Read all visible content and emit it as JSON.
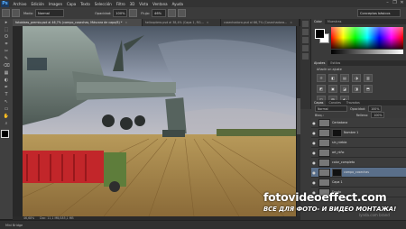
{
  "app": {
    "logo": "Ps"
  },
  "menubar": {
    "items": [
      "Archivo",
      "Edición",
      "Imagen",
      "Capa",
      "Texto",
      "Selección",
      "Filtro",
      "3D",
      "Vista",
      "Ventana",
      "Ayuda"
    ]
  },
  "window_controls": [
    "–",
    "❐",
    "✕"
  ],
  "options_bar": {
    "mode_label": "Modo:",
    "mode_value": "Normal",
    "opacity_label": "Opacidad:",
    "opacity_value": "100%",
    "flow_label": "Flujo:",
    "flow_value": "46%",
    "workspace": "Conceptos básicos"
  },
  "tools": [
    "▸",
    "⬚",
    "ʘ",
    "⌗",
    "✂",
    "✎",
    "⌫",
    "▦",
    "◐",
    "✒",
    "T",
    "↖",
    "▭",
    "✋",
    "⌕",
    "■"
  ],
  "document_tabs": [
    {
      "label": "fotoideas_premio.psd al 46,7% (campo_cosechas, Máscara de capa/8) *",
      "active": true
    },
    {
      "label": "helicoptero.psd al 38,4% (Capa 1, RG...",
      "active": false
    },
    {
      "label": "cosechadora.psd al 66,7% (Cosechadora...",
      "active": false
    }
  ],
  "status_bar": {
    "zoom": "46,68%",
    "doc": "Doc: 11,1 MB/185,1 MB"
  },
  "mini_bridge": "Mini Bridge",
  "panels": {
    "color_tabs": [
      "Color",
      "Muestras"
    ],
    "adjust_tabs": [
      "Ajustes",
      "Estilos"
    ],
    "adjust_title": "Añadir un ajuste",
    "adjust_icons": [
      "☼",
      "◧",
      "▤",
      "◑",
      "▥",
      "◩",
      "▣",
      "◪",
      "◨",
      "⬒",
      "◫",
      "▧",
      "◐"
    ],
    "layers_tabs": [
      "Capas",
      "Canales",
      "Trazados"
    ],
    "blend_label": "Normal",
    "opacity_label": "Opacidad:",
    "opacity_value": "100%",
    "fill_label": "Relleno:",
    "fill_value": "100%",
    "lock_label": "Bloq.:",
    "layers": [
      {
        "name": "Cerbatana",
        "selected": false
      },
      {
        "name": "Nombre 1",
        "selected": false
      },
      {
        "name": "sin_niebla",
        "selected": false
      },
      {
        "name": "art_niño",
        "selected": false
      },
      {
        "name": "color_completo",
        "selected": false
      },
      {
        "name": "campo_cosechas",
        "selected": true
      },
      {
        "name": "Capa 1",
        "selected": false
      },
      {
        "name": "Fondo",
        "selected": false
      }
    ]
  },
  "watermark": {
    "line1": "fotovideoeffect.com",
    "line2": "ВСЕ ДЛЯ ФОТО- И ВИДЕО МОНТАЖА!",
    "line3": "lynda.com brand"
  }
}
